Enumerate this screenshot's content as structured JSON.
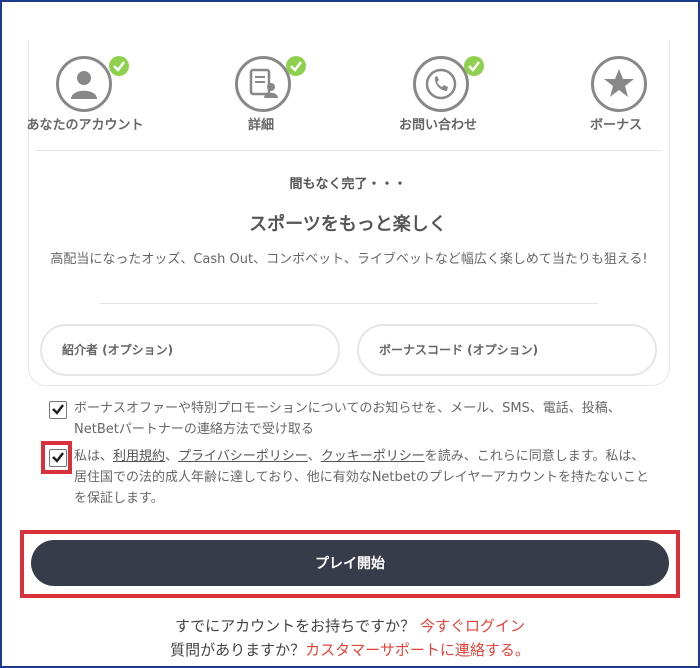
{
  "steps": [
    {
      "label": "あなたのアカウント",
      "icon": "user-icon",
      "completed": true
    },
    {
      "label": "詳細",
      "icon": "document-user-icon",
      "completed": true
    },
    {
      "label": "お問い合わせ",
      "icon": "phone-icon",
      "completed": true
    },
    {
      "label": "ボーナス",
      "icon": "star-icon",
      "completed": false
    }
  ],
  "status": {
    "almost_done": "間もなく完了・・・",
    "headline": "スポーツをもっと楽しく",
    "description": "高配当になったオッズ、Cash Out、コンボベット、ライブベットなど幅広く楽しめて当たりも狙える!"
  },
  "fields": {
    "referrer_placeholder": "紹介者 (オプション)",
    "bonus_code_placeholder": "ボーナスコード (オプション)"
  },
  "consents": {
    "marketing_text": "ボーナスオファーや特別プロモーションについてのお知らせを、メール、SMS、電話、投稿、NetBetパートナーの連絡方法で受け取る",
    "marketing_checked": true,
    "terms_prefix": "私は、",
    "terms_link": "利用規約",
    "terms_sep1": "、",
    "privacy_link": "プライバシーポリシー",
    "terms_sep2": "、",
    "cookie_link": "クッキーポリシー",
    "terms_suffix": "を読み、これらに同意します。私は、居住国での法的成人年齢に達しており、他に有効なNetbetのプレイヤーアカウントを持たないことを保証します。",
    "terms_checked": true
  },
  "actions": {
    "play_label": "プレイ開始"
  },
  "footer": {
    "account_question": "すでにアカウントをお持ちですか？",
    "login_link": "今すぐログイン",
    "help_question": "質問がありますか？",
    "support_link": "カスタマーサポートに連絡する。"
  },
  "colors": {
    "accent_red": "#d8313b",
    "button_dark": "#383b49",
    "check_green": "#8fd14f",
    "link": "#e5433a"
  }
}
